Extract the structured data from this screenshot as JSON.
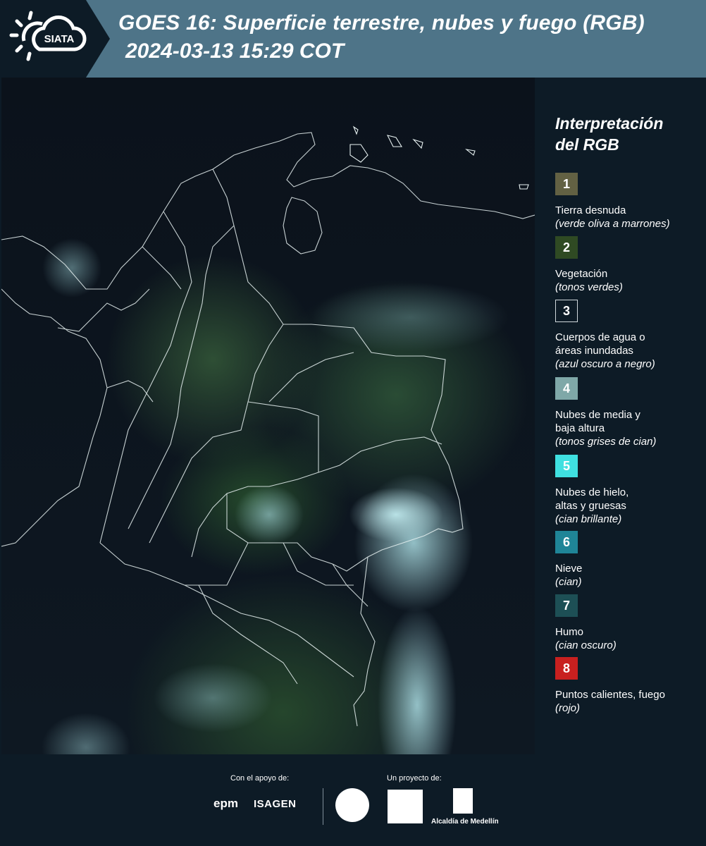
{
  "header": {
    "logo_text": "SIATA",
    "title": "GOES 16: Superficie terrestre, nubes y fuego (RGB)",
    "subtitle": "2024-03-13 15:29 COT"
  },
  "legend": {
    "title_line1": "Interpretación",
    "title_line2": "del RGB",
    "items": [
      {
        "number": "1",
        "label_line1": "Tierra desnuda",
        "label_line2": "",
        "desc": "(verde oliva a marrones)",
        "color": "#626143"
      },
      {
        "number": "2",
        "label_line1": "Vegetación",
        "label_line2": "",
        "desc": "(tonos verdes)",
        "color": "#2f4a23"
      },
      {
        "number": "3",
        "label_line1": "Cuerpos de agua o",
        "label_line2": "áreas inundadas",
        "desc": "(azul oscuro a negro)",
        "color": "#0d1b26"
      },
      {
        "number": "4",
        "label_line1": "Nubes de media y",
        "label_line2": "baja altura",
        "desc": "(tonos grises de cian)",
        "color": "#7fa8a8"
      },
      {
        "number": "5",
        "label_line1": "Nubes de hielo,",
        "label_line2": "altas y gruesas",
        "desc": "(cian brillante)",
        "color": "#3fe0e0"
      },
      {
        "number": "6",
        "label_line1": "Nieve",
        "label_line2": "",
        "desc": "(cian)",
        "color": "#1f8597"
      },
      {
        "number": "7",
        "label_line1": "Humo",
        "label_line2": "",
        "desc": "(cian oscuro)",
        "color": "#1d4f55"
      },
      {
        "number": "8",
        "label_line1": "Puntos calientes, fuego",
        "label_line2": "",
        "desc": "(rojo)",
        "color": "#c8201f"
      }
    ]
  },
  "footer": {
    "support_label": "Con el apoyo de:",
    "project_label": "Un proyecto de:",
    "epm": "epm",
    "isagen": "ISAGEN",
    "alcaldia": "Alcaldía de Medellín"
  },
  "colors": {
    "header_band": "#4e7488",
    "background": "#0d1b26"
  }
}
